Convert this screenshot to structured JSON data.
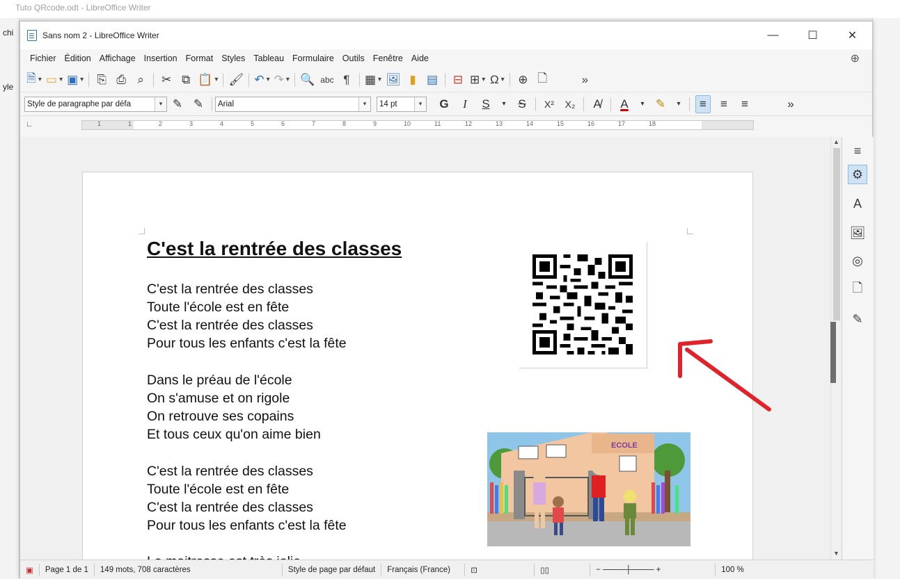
{
  "background_window": {
    "title": "Tuto QRcode.odt - LibreOffice Writer",
    "left_labels": [
      "chi",
      "yle"
    ]
  },
  "window": {
    "title": "Sans nom 2 - LibreOffice Writer",
    "minimize": "—",
    "maximize": "☐",
    "close": "✕"
  },
  "menu": [
    "Fichier",
    "Édition",
    "Affichage",
    "Insertion",
    "Format",
    "Styles",
    "Tableau",
    "Formulaire",
    "Outils",
    "Fenêtre",
    "Aide"
  ],
  "formatting": {
    "paragraph_style": "Style de paragraphe par défa",
    "font_name": "Arial",
    "font_size": "14 pt",
    "bold": "G",
    "italic": "I",
    "underline": "S",
    "strike": "S",
    "superscript": "X²",
    "subscript": "X₂"
  },
  "ruler_numbers": [
    "1",
    "1",
    "2",
    "3",
    "4",
    "5",
    "6",
    "7",
    "8",
    "9",
    "10",
    "11",
    "12",
    "13",
    "14",
    "15",
    "16",
    "17",
    "18"
  ],
  "document": {
    "title": "C'est la rentrée des classes",
    "stanza1": [
      "C'est la rentrée des classes",
      "Toute l'école est en fête",
      "C'est la rentrée des classes",
      "Pour tous les enfants c'est la fête"
    ],
    "stanza2": [
      "Dans le préau de l'école",
      "On s'amuse et on rigole",
      "On retrouve ses copains",
      "Et tous ceux qu'on aime bien"
    ],
    "stanza3": [
      "C'est la rentrée des classes",
      "Toute l'école est en fête",
      "C'est la rentrée des classes",
      "Pour tous les enfants c'est la fête"
    ],
    "stanza4": [
      "La maitresse est très jolie"
    ],
    "school_sign": "ECOLE"
  },
  "statusbar": {
    "page": "Page 1 de 1",
    "words": "149 mots, 708 caractères",
    "page_style": "Style de page par défaut",
    "language": "Français (France)",
    "zoom": "100 %"
  },
  "colors": {
    "accent": "#2a6ebd",
    "arrow": "#e0222b",
    "active_button": "#cfe3f7"
  }
}
